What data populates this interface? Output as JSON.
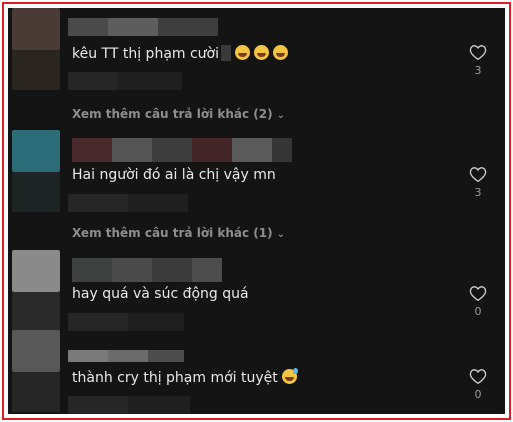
{
  "comments": [
    {
      "text": "kêu TT thị phạm cười",
      "likes": "3",
      "emoji": [
        "grinning-squint-icon",
        "grinning-squint-icon",
        "grinning-squint-icon"
      ]
    },
    {
      "text": "Hai người đó ai là chị vậy mn",
      "likes": "3"
    },
    {
      "text": "hay quá và súc động quá",
      "likes": "0"
    },
    {
      "text": "thành cry thị phạm mới tuyệt",
      "likes": "0",
      "emoji": [
        "sweat-smile-icon"
      ]
    }
  ],
  "replies": [
    {
      "label": "Xem thêm câu trả lời khác (2)"
    },
    {
      "label": "Xem thêm câu trả lời khác (1)"
    }
  ],
  "colors": {
    "background": "#141414",
    "border": "#d81f26",
    "text": "#e9e9e9",
    "muted": "#8e8e8e"
  }
}
